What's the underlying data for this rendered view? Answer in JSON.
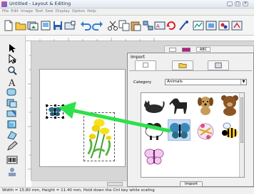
{
  "window": {
    "title": "Untitled - Layout & Editing",
    "controls": [
      "_",
      "□",
      "×"
    ]
  },
  "menu": [
    "File",
    "Edit",
    "Image",
    "Text",
    "Sew",
    "Display",
    "Option",
    "Help"
  ],
  "panel_header": {
    "tab_label": "ABC"
  },
  "import_panel": {
    "title": "Import",
    "category_label": "Category",
    "category_value": "Animals",
    "import_button": "Import"
  },
  "status": {
    "text": "Width = 15.80 mm, Height = 11.40 mm, Hold down the Ctrl key while scaling"
  },
  "colors": {
    "arrow": "#2ee04a",
    "selection_highlight": "#c6dcf4",
    "canvas_bg": "#d6d6d6"
  },
  "icons": {
    "toolbar": [
      "new-icon",
      "open-icon",
      "import-icon",
      "export-icon",
      "save-icon",
      "card-icon",
      "undo-icon",
      "redo-icon",
      "cut-icon",
      "copy-icon",
      "paste-icon",
      "distribute-icon",
      "sew-simulator-icon",
      "rotate-icon",
      "stitch-icon",
      "design-icon",
      "preview-icon",
      "zoom-icon",
      "grid-icon",
      "palette-icon",
      "sew-icon"
    ],
    "tools": [
      "select-icon",
      "point-edit-icon",
      "zoom-icon",
      "text-icon",
      "shape-icon",
      "drawing-icon",
      "paint-icon",
      "stitch-icon",
      "eraser-icon",
      "pen-icon",
      "barcode-icon",
      "hoop-icon"
    ],
    "gallery": [
      "cat-icon",
      "horse-icon",
      "dog-icon",
      "bear-icon",
      "sheep-icon",
      "butterfly-icon",
      "ladybug-icon",
      "bee-icon",
      "butterfly-small-icon"
    ]
  }
}
